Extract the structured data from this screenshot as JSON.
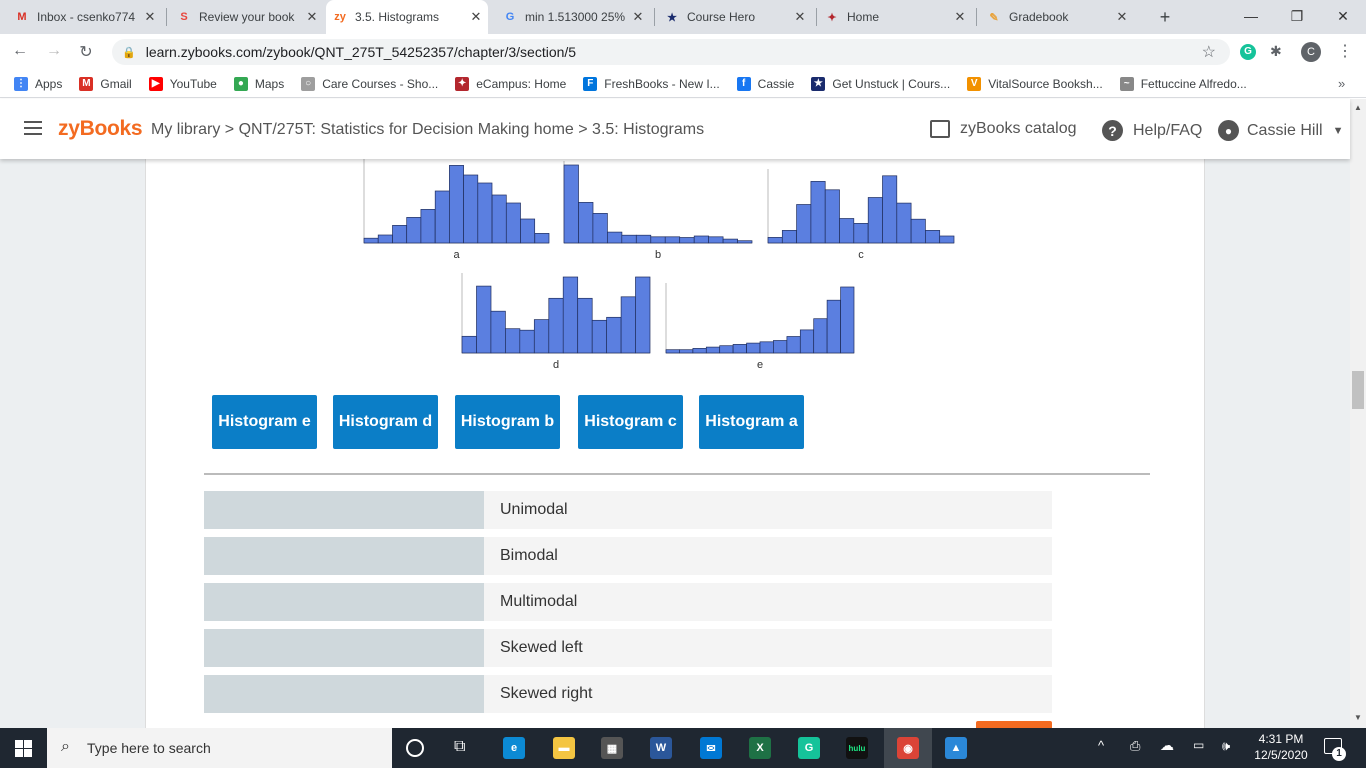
{
  "browser": {
    "tabs": [
      {
        "title": "Inbox - csenko774",
        "icon": "gmail-icon",
        "color": "#d93025",
        "glyph": "M"
      },
      {
        "title": "Review your book",
        "icon": "scribd-icon",
        "color": "#e8453c",
        "glyph": "S"
      },
      {
        "title": "3.5. Histograms",
        "icon": "zybooks-icon",
        "color": "#f36b21",
        "glyph": "zy"
      },
      {
        "title": "min 1.513000 25%",
        "icon": "google-icon",
        "color": "#4285f4",
        "glyph": "G"
      },
      {
        "title": "Course Hero",
        "icon": "coursehero-icon",
        "color": "#1a2b6d",
        "glyph": "★"
      },
      {
        "title": "Home",
        "icon": "phoenix-icon",
        "color": "#b3272e",
        "glyph": "✦"
      },
      {
        "title": "Gradebook",
        "icon": "gradebook-icon",
        "color": "#e8a33d",
        "glyph": "✎"
      }
    ],
    "new_tab": "+",
    "close_glyph": "✕",
    "url": "learn.zybooks.com/zybook/QNT_275T_54252357/chapter/3/section/5",
    "profile_initial": "C",
    "bookmarks": [
      {
        "label": "Apps",
        "color": "#4285f4",
        "glyph": "⋮"
      },
      {
        "label": "Gmail",
        "color": "#d93025",
        "glyph": "M"
      },
      {
        "label": "YouTube",
        "color": "#ff0000",
        "glyph": "▶"
      },
      {
        "label": "Maps",
        "color": "#34a853",
        "glyph": "●"
      },
      {
        "label": "Care Courses - Sho...",
        "color": "#9e9e9e",
        "glyph": "○"
      },
      {
        "label": "eCampus: Home",
        "color": "#b3272e",
        "glyph": "✦"
      },
      {
        "label": "FreshBooks - New I...",
        "color": "#0075dd",
        "glyph": "F"
      },
      {
        "label": "Cassie",
        "color": "#1877f2",
        "glyph": "f"
      },
      {
        "label": "Get Unstuck | Cours...",
        "color": "#1a2b6d",
        "glyph": "★"
      },
      {
        "label": "VitalSource Booksh...",
        "color": "#f29100",
        "glyph": "V"
      },
      {
        "label": "Fettuccine Alfredo...",
        "color": "#888888",
        "glyph": "~"
      }
    ],
    "more": "»"
  },
  "zybooks": {
    "logo": "zyBooks",
    "breadcrumb": "My library > QNT/275T: Statistics for Decision Making home > 3.5: Histograms",
    "catalog": "zyBooks catalog",
    "help": "Help/FAQ",
    "user": "Cassie Hill"
  },
  "histograms": [
    {
      "label": "a",
      "values": [
        0.06,
        0.1,
        0.22,
        0.32,
        0.42,
        0.65,
        0.97,
        0.85,
        0.75,
        0.6,
        0.5,
        0.3,
        0.12
      ]
    },
    {
      "label": "b",
      "values": [
        1.0,
        0.52,
        0.38,
        0.14,
        0.1,
        0.1,
        0.08,
        0.08,
        0.07,
        0.09,
        0.08,
        0.05,
        0.03
      ]
    },
    {
      "label": "c",
      "values": [
        0.08,
        0.18,
        0.55,
        0.88,
        0.76,
        0.35,
        0.28,
        0.65,
        0.96,
        0.57,
        0.34,
        0.18,
        0.1
      ]
    },
    {
      "label": "d",
      "values": [
        0.22,
        0.88,
        0.55,
        0.32,
        0.3,
        0.44,
        0.72,
        1.0,
        0.72,
        0.43,
        0.47,
        0.74,
        1.0
      ]
    },
    {
      "label": "e",
      "values": [
        0.05,
        0.05,
        0.07,
        0.09,
        0.11,
        0.13,
        0.15,
        0.17,
        0.19,
        0.25,
        0.35,
        0.52,
        0.8,
        1.0
      ]
    }
  ],
  "buttons": [
    "Histogram e",
    "Histogram d",
    "Histogram b",
    "Histogram c",
    "Histogram a"
  ],
  "targets": [
    "Unimodal",
    "Bimodal",
    "Multimodal",
    "Skewed left",
    "Skewed right"
  ],
  "colors": {
    "bar": "#5b7fe0",
    "bar_stroke": "#1f2d5c",
    "button": "#0b7ec7",
    "accent": "#f36b21"
  },
  "taskbar": {
    "search_placeholder": "Type here to search",
    "time": "4:31 PM",
    "date": "12/5/2020",
    "notifications": "1",
    "apps": [
      {
        "name": "edge-icon",
        "color": "#0c8ad4",
        "glyph": "e"
      },
      {
        "name": "file-explorer-icon",
        "color": "#f4c542",
        "glyph": "▬"
      },
      {
        "name": "store-icon",
        "color": "#555555",
        "glyph": "▦"
      },
      {
        "name": "word-icon",
        "color": "#2b579a",
        "glyph": "W"
      },
      {
        "name": "mail-icon",
        "color": "#0078d4",
        "glyph": "✉"
      },
      {
        "name": "excel-icon",
        "color": "#1e7145",
        "glyph": "X"
      },
      {
        "name": "grammarly-icon",
        "color": "#15c39a",
        "glyph": "G"
      },
      {
        "name": "hulu-icon",
        "color": "#111111",
        "glyph": "hulu"
      },
      {
        "name": "chrome-icon",
        "color": "#db4437",
        "glyph": "◉"
      },
      {
        "name": "photos-icon",
        "color": "#2b88d8",
        "glyph": "▲"
      }
    ]
  }
}
